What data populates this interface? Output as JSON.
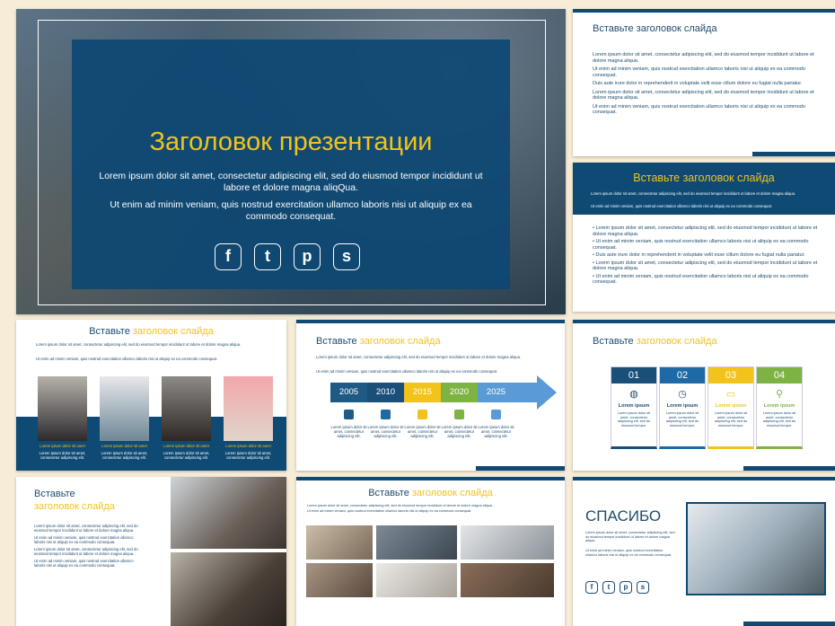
{
  "main": {
    "title": "Заголовок презентации",
    "p1": "Lorem ipsum dolor sit amet, consectetur adipiscing elit, sed do eiusmod tempor incididunt ut labore et dolore magna aliqQua.",
    "p2": "Ut enim ad minim veniam, quis nostrud exercitation ullamco laboris nisi ut aliquip ex ea commodo consequat.",
    "social_icons": [
      "facebook-icon",
      "twitter-icon",
      "pinterest-icon",
      "skype-icon"
    ]
  },
  "s2": {
    "title": "Вставьте заголовок слайда",
    "paras": [
      "Lorem ipsum dolor sit amet, consectetur adipiscing elit, sed do eiusmod tempor incididunt ut labore et dolore magna aliqua.",
      "Ut enim ad minim veniam, quis nostrud exercitation ullamco laboris nisi ut aliquip ex ea commodo consequat.",
      "Duis aute irure dolor in reprehenderit in voluptate velit esse cillum dolore eu fugiat nulla pariatur.",
      "Lorem ipsum dolor sit amet, consectetur adipiscing elit, sed do eiusmod tempor incididunt ut labore et dolore magna aliqua.",
      "Ut enim ad minim veniam, quis nostrud exercitation ullamco laboris nisi ut aliquip ex ea commodo consequat."
    ]
  },
  "s3": {
    "title": "Вставьте заголовок слайда",
    "top1": "Lorem ipsum dolor sit amet, consectetur adipiscing elit, sed do eiusmod tempor incididunt ut labore et dolore magna aliqua.",
    "top2": "Ut enim ad minim veniam, quis nostrud exercitation ullamco laboris nisi ut aliquip ex ea commodo consequat.",
    "bullets": [
      "Lorem ipsum dolor sit amet, consectetur adipiscing elit, sed do eiusmod tempor incididunt ut labore et dolore magna aliqua.",
      "Ut enim ad minim veniam, quis nostrud exercitation ullamco laboris nisi ut aliquip ex ea commodo consequat.",
      "Duis aute irure dolor in reprehenderit in voluptate velit esse cillum dolore eu fugiat nulla pariatur.",
      "Lorem ipsum dolor sit amet, consectetur adipiscing elit, sed do eiusmod tempor incididunt ut labore et dolore magna aliqua.",
      "Ut enim ad minim veniam, quis nostrud exercitation ullamco laboris nisi ut aliquip ex ea commodo consequat."
    ]
  },
  "s4": {
    "title_a": "Вставьте ",
    "title_b": "заголовок слайда",
    "l1": "Lorem ipsum dolor sit amet, consectetur adipiscing elit, sed do eiusmod tempor incididunt ut labore et dolore magna aliqua.",
    "l2": "Ut enim ad minim veniam, quis nostrud exercitation ullamco laboris nisi ut aliquip ex ea commodo consequat.",
    "cap": "Lorem ipsum dolor sit amet",
    "desc": "Lorem ipsum dolor sit amet, consectetur adipiscing elit."
  },
  "s5": {
    "title_a": "Вставьте ",
    "title_b": "заголовок слайда",
    "l1": "Lorem ipsum dolor sit amet, consectetur adipiscing elit, sed do eiusmod tempor incididunt ut labore et dolore magna aliqua.",
    "l2": "Ut enim ad minim veniam, quis nostrud exercitation ullamco laboris nisi ut aliquip ex ea commodo consequat.",
    "years": [
      "2005",
      "2010",
      "2015",
      "2020",
      "2025"
    ],
    "year_colors": [
      "#1f5a86",
      "#1f5a86",
      "#f2c31b",
      "#7cb342",
      "#5b9bd5"
    ],
    "desc": "Lorem ipsum dolor sit amet, consectetur adipiscing elit."
  },
  "s6": {
    "title_a": "Вставьте ",
    "title_b": "заголовок слайда",
    "nums": [
      "01",
      "02",
      "03",
      "04"
    ],
    "colors": [
      "#1a4f7a",
      "#1f6aa5",
      "#f2c31b",
      "#7cb342"
    ],
    "icons": [
      "globe-icon",
      "clock-icon",
      "folder-icon",
      "location-icon"
    ],
    "label": "Lorem ipsum",
    "desc": "Lorem ipsum dolor sit amet, consectetur adipiscing elit, sed do eiusmod tempor."
  },
  "s7": {
    "title_a": "Вставьте",
    "title_b": "заголовок слайда",
    "p1": "Lorem ipsum dolor sit amet, consectetur adipiscing elit, sed do eiusmod tempor incididunt ut labore et dolore magna aliqua.",
    "p2": "Ut enim ad minim veniam, quis nostrud exercitation ullamco laboris nisi ut aliquip ex ea commodo consequat.",
    "p3": "Lorem ipsum dolor sit amet, consectetur adipiscing elit, sed do eiusmod tempor incididunt ut labore et dolore magna aliqua.",
    "p4": "Ut enim ad minim veniam, quis nostrud exercitation ullamco laboris nisi ut aliquip ex ea commodo consequat."
  },
  "s8": {
    "title_a": "Вставьте ",
    "title_b": "заголовок слайда",
    "l1": "Lorem ipsum dolor sit amet, consectetur adipiscing elit, sed do eiusmod tempor incididunt ut labore et dolore magna aliqua.",
    "l2": "Ut enim ad minim veniam, quis nostrud exercitation ullamco laboris nisi ut aliquip ex ea commodo consequat."
  },
  "s9": {
    "title": "СПАСИБО",
    "p1": "Lorem ipsum dolor sit amet, consectetur adipiscing elit, sed do eiusmod tempor incididunt ut labore et dolore magna aliqua.",
    "p2": "Ut enim ad minim veniam, quis nostrud exercitation ullamco laboris nisi ut aliquip ex ea commodo consequat."
  }
}
